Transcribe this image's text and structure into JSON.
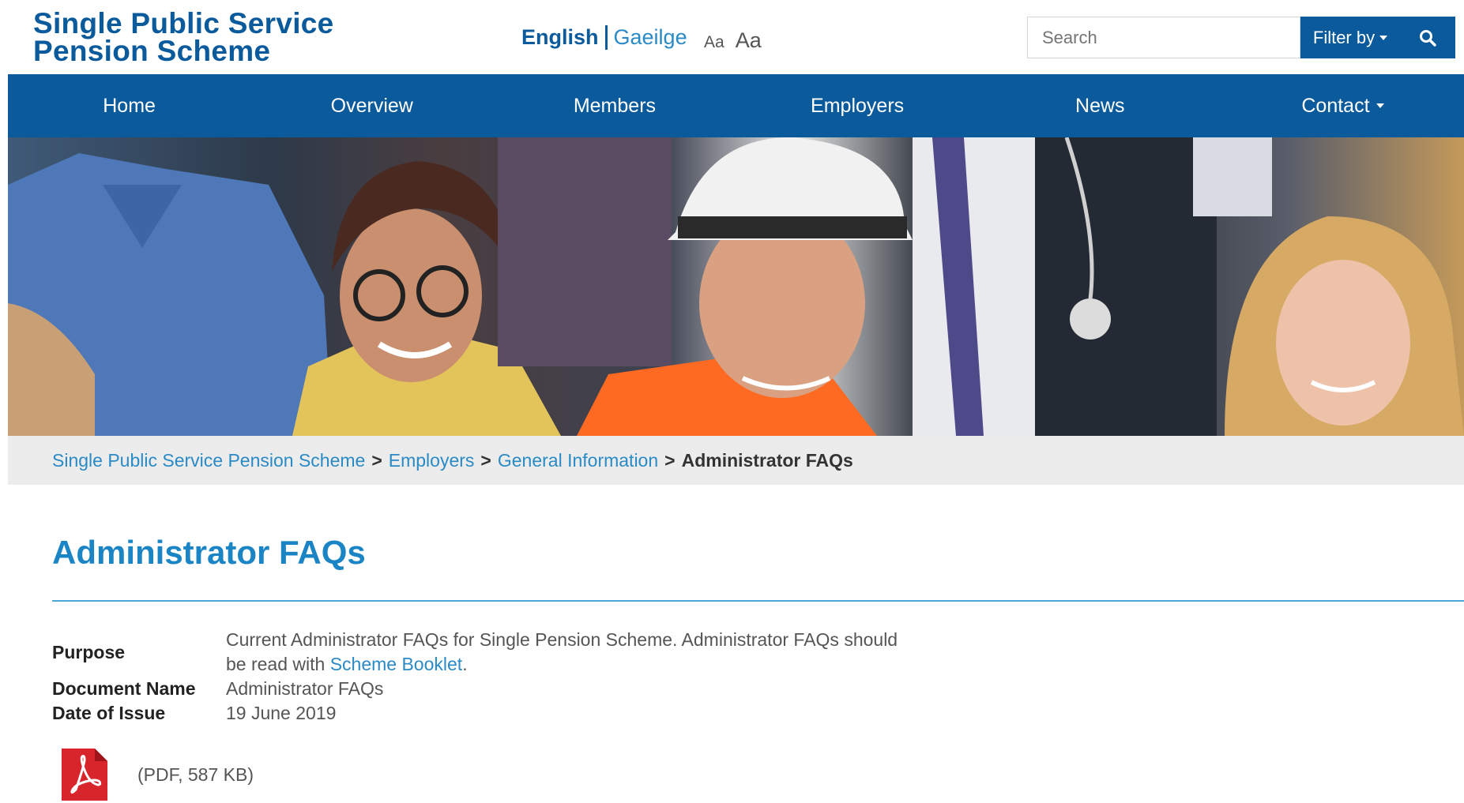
{
  "header": {
    "logo_line1": "Single Public Service",
    "logo_line2": "Pension Scheme",
    "lang_english": "English",
    "lang_irish": "Gaeilge",
    "font_small": "Aa",
    "font_large": "Aa",
    "search_placeholder": "Search",
    "filter_label": "Filter by"
  },
  "nav": {
    "items": [
      {
        "label": "Home"
      },
      {
        "label": "Overview"
      },
      {
        "label": "Members"
      },
      {
        "label": "Employers"
      },
      {
        "label": "News"
      },
      {
        "label": "Contact"
      }
    ]
  },
  "breadcrumb": {
    "items": [
      "Single Public Service Pension Scheme",
      "Employers",
      "General Information"
    ],
    "separator": ">",
    "current": "Administrator FAQs"
  },
  "page": {
    "title": "Administrator FAQs",
    "purpose_label": "Purpose",
    "purpose_text_1": "Current Administrator FAQs for Single Pension Scheme. Administrator FAQs should",
    "purpose_text_2": "be read with ",
    "purpose_link": "Scheme Booklet",
    "purpose_text_3": ".",
    "docname_label": "Document Name",
    "docname_value": "Administrator FAQs",
    "date_label": "Date of Issue",
    "date_value": "19 June 2019",
    "pdf_info": "(PDF, 587 KB)"
  },
  "colors": {
    "brand_blue": "#0a5a9c",
    "link_blue": "#2a8ac6",
    "title_blue": "#1a84c4",
    "pdf_red": "#d7252b"
  },
  "icons": {
    "search": "search-icon",
    "filter_caret": "caret-down-icon",
    "contact_caret": "caret-down-icon",
    "pdf": "pdf-icon"
  }
}
